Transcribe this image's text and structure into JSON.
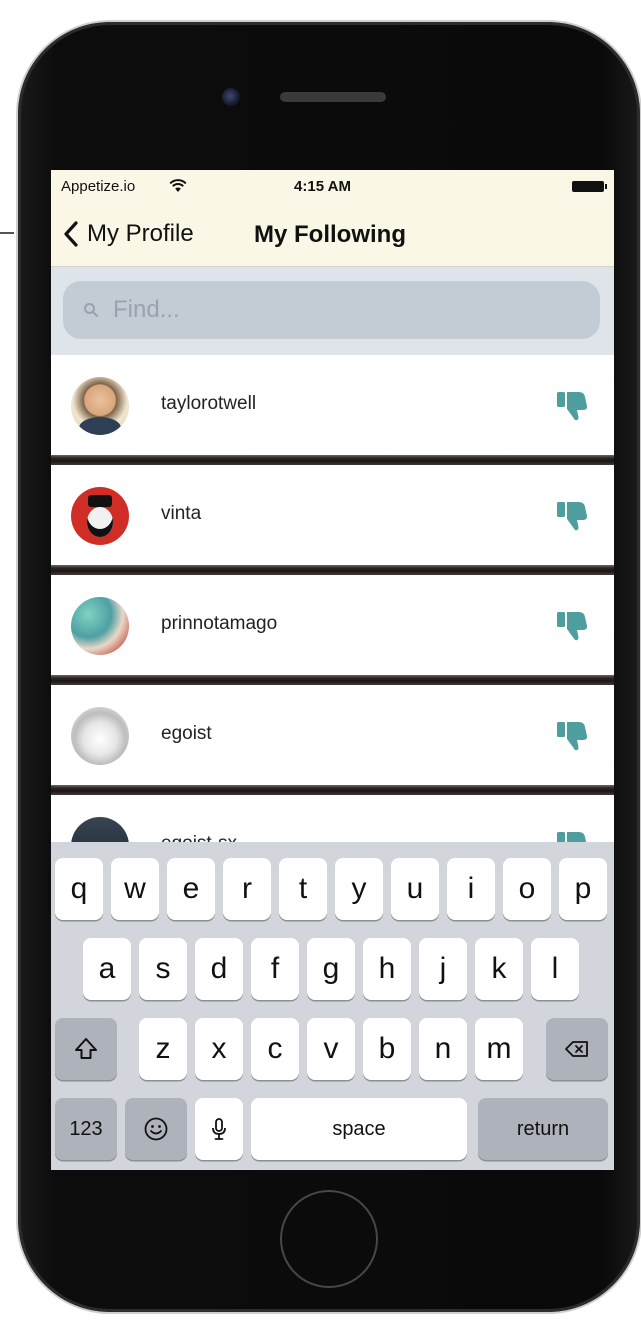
{
  "status_bar": {
    "carrier": "Appetize.io",
    "time": "4:15 AM"
  },
  "nav": {
    "back_label": "My Profile",
    "title": "My Following"
  },
  "search": {
    "placeholder": "Find..."
  },
  "following": [
    {
      "username": "taylorotwell",
      "action_icon": "thumbs-down-icon"
    },
    {
      "username": "vinta",
      "action_icon": "thumbs-down-icon"
    },
    {
      "username": "prinnotamago",
      "action_icon": "thumbs-down-icon"
    },
    {
      "username": "egoist",
      "action_icon": "thumbs-down-icon"
    },
    {
      "username": "egoist-sx",
      "action_icon": "thumbs-down-icon"
    }
  ],
  "keyboard": {
    "row1": [
      "q",
      "w",
      "e",
      "r",
      "t",
      "y",
      "u",
      "i",
      "o",
      "p"
    ],
    "row2": [
      "a",
      "s",
      "d",
      "f",
      "g",
      "h",
      "j",
      "k",
      "l"
    ],
    "row3": [
      "z",
      "x",
      "c",
      "v",
      "b",
      "n",
      "m"
    ],
    "numbers_label": "123",
    "space_label": "space",
    "return_label": "return"
  },
  "colors": {
    "nav_background": "#fbf7e6",
    "accent_teal": "#4f9e9f",
    "search_background": "#c3cbd4",
    "keyboard_background": "#d2d6dc"
  }
}
